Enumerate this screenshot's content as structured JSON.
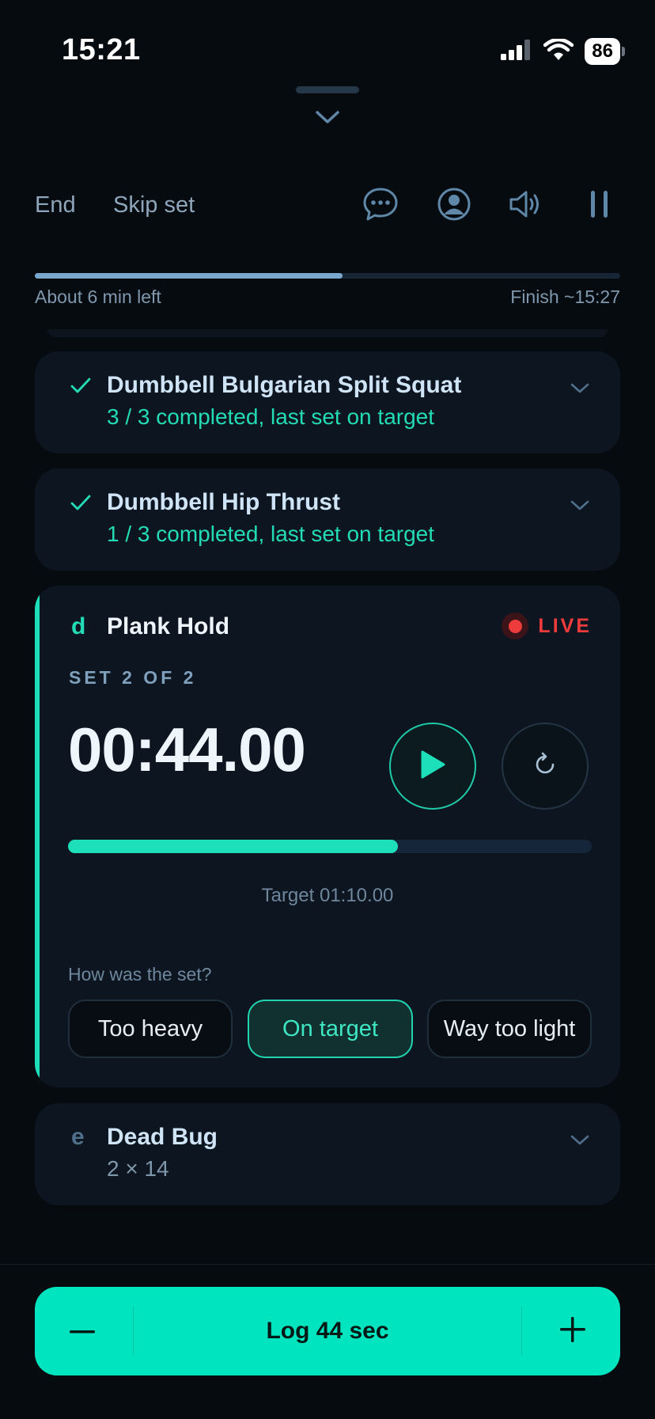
{
  "status_bar": {
    "time": "15:21",
    "battery": "86"
  },
  "header": {
    "end_label": "End",
    "skip_label": "Skip set"
  },
  "session_progress": {
    "fraction": 0.525,
    "time_left": "About 6 min left",
    "finish": "Finish ~15:27"
  },
  "exercises_done": [
    {
      "name": "Dumbbell Bulgarian Split Squat",
      "status": "3 / 3 completed, last set on target"
    },
    {
      "name": "Dumbbell Hip Thrust",
      "status": "1 / 3 completed, last set on target"
    }
  ],
  "active_exercise": {
    "letter": "d",
    "name": "Plank Hold",
    "live_label": "LIVE",
    "set_label": "SET 2 OF 2",
    "timer": "00:44.00",
    "progress_fraction": 0.63,
    "target": "Target 01:10.00",
    "question": "How was the set?",
    "options": [
      "Too heavy",
      "On target",
      "Way too light"
    ],
    "selected_option": "On target"
  },
  "next_exercise": {
    "letter": "e",
    "name": "Dead Bug",
    "detail": "2 × 14"
  },
  "log_button": {
    "label": "Log 44 sec",
    "minus": "−",
    "plus": "+"
  },
  "colors": {
    "accent": "#1de0bb",
    "live": "#ee3b3b",
    "background": "#060b10",
    "card": "#0d1620"
  },
  "icons": [
    "signal-icon",
    "wifi-icon",
    "chevron-down-icon",
    "chat-icon",
    "profile-icon",
    "speaker-icon",
    "pause-icon",
    "check-icon",
    "play-icon",
    "reset-icon",
    "minus-icon",
    "plus-icon"
  ]
}
